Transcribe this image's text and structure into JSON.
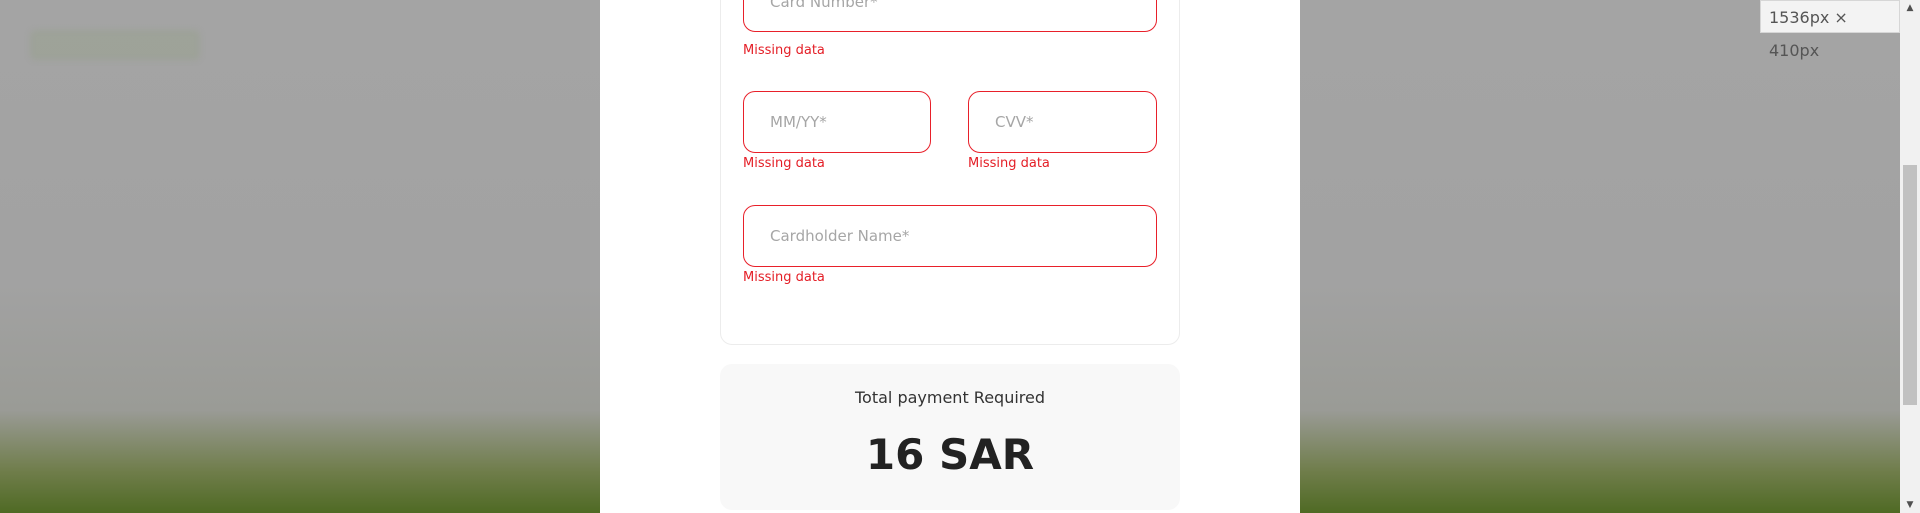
{
  "form": {
    "card_number": {
      "placeholder": "Card Number*",
      "error": "Missing data"
    },
    "expiry": {
      "placeholder": "MM/YY*",
      "error": "Missing data"
    },
    "cvv": {
      "placeholder": "CVV*",
      "error": "Missing data"
    },
    "cardholder": {
      "placeholder": "Cardholder Name*",
      "error": "Missing data"
    }
  },
  "total": {
    "label": "Total payment Required",
    "amount": "16 SAR"
  },
  "devtools": {
    "viewport_size": "1536px × 410px"
  },
  "icons": {
    "scroll_up": "triangle-up",
    "scroll_down": "triangle-down"
  },
  "colors": {
    "error": "#e41e26",
    "field_border_error": "#e8202a",
    "total_box_bg": "#f8f8f8"
  }
}
